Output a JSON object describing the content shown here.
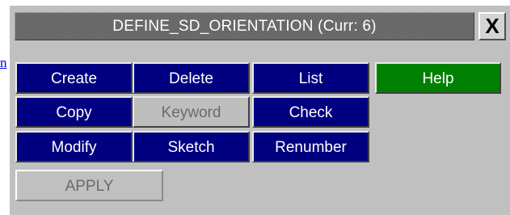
{
  "stray_link": {
    "text": "n"
  },
  "window": {
    "title": "DEFINE_SD_ORIENTATION (Curr: 6)",
    "close_label": "X"
  },
  "buttons": {
    "create": "Create",
    "delete": "Delete",
    "list": "List",
    "help": "Help",
    "copy": "Copy",
    "keyword": "Keyword",
    "check": "Check",
    "modify": "Modify",
    "sketch": "Sketch",
    "renumber": "Renumber",
    "apply": "APPLY"
  },
  "colors": {
    "panel": "#c0c0c0",
    "button_blue": "#000080",
    "help_green": "#008000",
    "disabled_gray": "#bebebe"
  }
}
